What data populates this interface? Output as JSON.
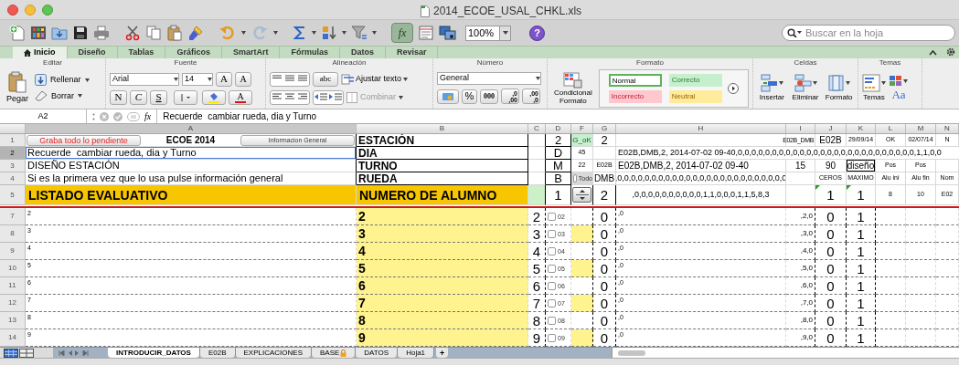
{
  "window": {
    "title": "2014_ECOE_USAL_CHKL.xls"
  },
  "toolbar": {
    "formula_button": "fx",
    "zoom": "100%",
    "help": "?",
    "search": {
      "placeholder": "Buscar en la hoja"
    }
  },
  "ribbon_tabs": [
    {
      "label": "Inicio",
      "selected": true
    },
    {
      "label": "Diseño",
      "selected": false
    },
    {
      "label": "Tablas",
      "selected": false
    },
    {
      "label": "Gráficos",
      "selected": false
    },
    {
      "label": "SmartArt",
      "selected": false
    },
    {
      "label": "Fórmulas",
      "selected": false
    },
    {
      "label": "Datos",
      "selected": false
    },
    {
      "label": "Revisar",
      "selected": false
    }
  ],
  "ribbon_groups": [
    {
      "kind": "edit",
      "label": "Editar",
      "paste": "Pegar",
      "fill": "Rellenar",
      "clear": "Borrar"
    },
    {
      "kind": "font",
      "label": "Fuente",
      "font": "Arial",
      "size": "14",
      "grow": "A",
      "shrink": "A",
      "bold": "N",
      "italic": "C",
      "underline": "S",
      "font_color": "A"
    },
    {
      "kind": "align",
      "label": "Alineación",
      "orientation": "abc",
      "wrap": "Ajustar texto",
      "merge": "Combinar",
      "merge_disabled": true
    },
    {
      "kind": "number",
      "label": "Número",
      "format": "General",
      "percent": "%",
      "thousands": "000",
      "decimals": [
        {
          "top": ",0",
          "bottom": ",00"
        },
        {
          "top": ",00",
          "bottom": ",0"
        }
      ]
    },
    {
      "kind": "styles",
      "label": "Formato",
      "conditional": "Condicional Formato",
      "styles": [
        {
          "label": "Normal",
          "selected": true,
          "color": "#ffffff"
        },
        {
          "label": "Correcto",
          "selected": false,
          "color": "#c6efce"
        },
        {
          "label": "Incorrecto",
          "selected": false,
          "color": "#ffc7ce"
        },
        {
          "label": "Neutral",
          "selected": false,
          "color": "#ffeb9c"
        }
      ]
    },
    {
      "kind": "cells",
      "label": "Celdas",
      "buttons": [
        "Insertar",
        "Eliminar",
        "Formato"
      ]
    },
    {
      "kind": "themes",
      "label": "Temas",
      "themes": "Temas",
      "fonts": "Aa"
    }
  ],
  "formula_bar": {
    "cell": "A2",
    "fx": "fx",
    "content": "Recuerde  cambiar rueda, dia y Turno"
  },
  "columns": [
    {
      "label": "A",
      "selected": true
    },
    {
      "label": "B",
      "selected": false
    },
    {
      "label": "C",
      "selected": false
    },
    {
      "label": "D",
      "selected": false
    },
    {
      "label": "F",
      "selected": false
    },
    {
      "label": "G",
      "selected": false
    },
    {
      "label": "H",
      "selected": false
    },
    {
      "label": "I",
      "selected": false
    },
    {
      "label": "J",
      "selected": false
    },
    {
      "label": "K",
      "selected": false
    },
    {
      "label": "L",
      "selected": false
    },
    {
      "label": "M",
      "selected": false
    },
    {
      "label": "N",
      "selected": false
    }
  ],
  "rows": [
    {
      "number": "1",
      "kind": "info",
      "selected": false,
      "cells": {
        "a": {
          "kind": "buttons",
          "items": [
            {
              "kind": "button",
              "text": "Graba todo lo pendiente",
              "alert": true
            },
            {
              "kind": "title",
              "text": "ECOE 2014"
            },
            {
              "kind": "button",
              "text": "Informacion General",
              "alert": false
            }
          ]
        },
        "b": {
          "kind": "label",
          "text": "ESTACIÓN"
        },
        "d": {
          "kind": "big",
          "text": "2"
        },
        "f": {
          "kind": "ok",
          "text": "G_oK"
        },
        "g": {
          "kind": "big",
          "text": "2"
        },
        "i": {
          "kind": "tiny",
          "text": "E02B_DMB"
        },
        "j": {
          "kind": "value",
          "text": "E02B"
        },
        "k": {
          "kind": "small",
          "text": "29/09/14"
        },
        "l": {
          "kind": "small",
          "text": "OK"
        },
        "m": {
          "kind": "small",
          "text": "02/07/14"
        },
        "n": {
          "kind": "small",
          "text": "N"
        }
      }
    },
    {
      "number": "2",
      "kind": "info",
      "selected": true,
      "cells": {
        "a": {
          "kind": "text",
          "text": "Recuerde  cambiar rueda, dia y Turno",
          "selected": true
        },
        "b": {
          "kind": "label",
          "text": "DIA"
        },
        "d": {
          "kind": "big",
          "text": "D"
        },
        "f": {
          "kind": "small",
          "text": "45"
        },
        "h": {
          "kind": "wide",
          "text": "E02B,DMB,2, 2014-07-02 09-40,0,0,0,0,0,0,0,0,0,0,0,0,0,0,0,0,0,0,0,0,0,0,0,0,0,0,1,1,0,0"
        }
      }
    },
    {
      "number": "3",
      "kind": "info",
      "selected": false,
      "cells": {
        "a": {
          "kind": "text",
          "text": "DISEÑO ESTACIÓN",
          "selected": false
        },
        "b": {
          "kind": "label",
          "text": "TURNO"
        },
        "d": {
          "kind": "big",
          "text": "M"
        },
        "f": {
          "kind": "small",
          "text": "22"
        },
        "g": {
          "kind": "small",
          "text": "E02B"
        },
        "h": {
          "kind": "data",
          "text": "E02B,DMB,2, 2014-07-02 09-40"
        },
        "i": {
          "kind": "value",
          "text": "15"
        },
        "j": {
          "kind": "value",
          "text": "90"
        },
        "k": {
          "kind": "boxed",
          "text": "diseño"
        },
        "l": {
          "kind": "small",
          "text": "Pos"
        },
        "m": {
          "kind": "small",
          "text": "Pos"
        }
      }
    },
    {
      "number": "4",
      "kind": "info",
      "selected": false,
      "cells": {
        "a": {
          "kind": "text",
          "text": "Si es la primera vez que lo usa pulse información general",
          "selected": false
        },
        "b": {
          "kind": "label",
          "text": "RUEDA"
        },
        "d": {
          "kind": "big",
          "text": "B"
        },
        "f": {
          "kind": "checkbox",
          "text": "Todo",
          "checked": false
        },
        "g": {
          "kind": "value",
          "text": "DMB"
        },
        "h": {
          "kind": "data_center",
          "text": ",0,0,0,0,0,0,0,0,0,0,0,0,0,0,0,0,0,0,0,0,0,0,0,0,0"
        },
        "j": {
          "kind": "small",
          "text": "CEROS"
        },
        "k": {
          "kind": "small",
          "text": "MAXIMO"
        },
        "l": {
          "kind": "small",
          "text": "Alu ini"
        },
        "m": {
          "kind": "small",
          "text": "Alu fin"
        },
        "n": {
          "kind": "small",
          "text": "Nom"
        }
      }
    },
    {
      "number": "5",
      "kind": "title",
      "selected": false,
      "cells": {
        "a": {
          "kind": "heading",
          "text": "LISTADO EVALUATIVO"
        },
        "b": {
          "kind": "heading",
          "text": "NUMERO DE ALUMNO"
        },
        "d": {
          "kind": "big",
          "text": "1"
        },
        "f": {
          "kind": "spinner"
        },
        "g": {
          "kind": "big",
          "text": "2"
        },
        "h": {
          "kind": "data_center",
          "text": ",0,0,0,0,0,0,0,0,0,0,1,1,0,0,0,1,1,5,8,3"
        },
        "j": {
          "kind": "big",
          "text": "1",
          "flag": true
        },
        "k": {
          "kind": "big",
          "text": "1",
          "flag": true
        },
        "l": {
          "kind": "small",
          "text": "8"
        },
        "m": {
          "kind": "small",
          "text": "10"
        },
        "n": {
          "kind": "small",
          "text": "E02"
        }
      }
    },
    {
      "number": "7",
      "kind": "item",
      "selected": false,
      "highlight": false,
      "cells": {
        "a": {
          "kind": "note",
          "text": "2"
        },
        "b": {
          "kind": "label",
          "text": "2"
        },
        "c": {
          "kind": "big",
          "text": "2"
        },
        "d": {
          "kind": "checkbox",
          "text": "02",
          "checked": false
        },
        "g": {
          "kind": "big",
          "text": "0"
        },
        "h": {
          "kind": "note",
          "text": ",0"
        },
        "i": {
          "kind": "note_right",
          "text": ",2,0"
        },
        "j": {
          "kind": "big",
          "text": "0"
        },
        "k": {
          "kind": "big",
          "text": "1"
        }
      }
    },
    {
      "number": "8",
      "kind": "item",
      "selected": false,
      "highlight": true,
      "cells": {
        "a": {
          "kind": "note",
          "text": "3"
        },
        "b": {
          "kind": "label",
          "text": "3"
        },
        "c": {
          "kind": "big",
          "text": "3"
        },
        "d": {
          "kind": "checkbox",
          "text": "03",
          "checked": false
        },
        "g": {
          "kind": "big",
          "text": "0"
        },
        "h": {
          "kind": "note",
          "text": ",0"
        },
        "i": {
          "kind": "note_right",
          "text": ",3,0"
        },
        "j": {
          "kind": "big",
          "text": "0"
        },
        "k": {
          "kind": "big",
          "text": "1"
        }
      }
    },
    {
      "number": "9",
      "kind": "item",
      "selected": false,
      "highlight": false,
      "cells": {
        "a": {
          "kind": "note",
          "text": "4"
        },
        "b": {
          "kind": "label",
          "text": "4"
        },
        "c": {
          "kind": "big",
          "text": "4"
        },
        "d": {
          "kind": "checkbox",
          "text": "04",
          "checked": false
        },
        "g": {
          "kind": "big",
          "text": "0"
        },
        "h": {
          "kind": "note",
          "text": ",0"
        },
        "i": {
          "kind": "note_right",
          "text": ",4,0"
        },
        "j": {
          "kind": "big",
          "text": "0"
        },
        "k": {
          "kind": "big",
          "text": "1"
        }
      }
    },
    {
      "number": "10",
      "kind": "item",
      "selected": false,
      "highlight": true,
      "cells": {
        "a": {
          "kind": "note",
          "text": "5"
        },
        "b": {
          "kind": "label",
          "text": "5"
        },
        "c": {
          "kind": "big",
          "text": "5"
        },
        "d": {
          "kind": "checkbox",
          "text": "05",
          "checked": false
        },
        "g": {
          "kind": "big",
          "text": "0"
        },
        "h": {
          "kind": "note",
          "text": ",0"
        },
        "i": {
          "kind": "note_right",
          "text": ",5,0"
        },
        "j": {
          "kind": "big",
          "text": "0"
        },
        "k": {
          "kind": "big",
          "text": "1"
        }
      }
    },
    {
      "number": "11",
      "kind": "item",
      "selected": false,
      "highlight": false,
      "cells": {
        "a": {
          "kind": "note",
          "text": "6"
        },
        "b": {
          "kind": "label",
          "text": "6"
        },
        "c": {
          "kind": "big",
          "text": "6"
        },
        "d": {
          "kind": "checkbox",
          "text": "06",
          "checked": false
        },
        "g": {
          "kind": "big",
          "text": "0"
        },
        "h": {
          "kind": "note",
          "text": ",0"
        },
        "i": {
          "kind": "note_right",
          "text": ",6,0"
        },
        "j": {
          "kind": "big",
          "text": "0"
        },
        "k": {
          "kind": "big",
          "text": "1"
        }
      }
    },
    {
      "number": "12",
      "kind": "item",
      "selected": false,
      "highlight": true,
      "cells": {
        "a": {
          "kind": "note",
          "text": "7"
        },
        "b": {
          "kind": "label",
          "text": "7"
        },
        "c": {
          "kind": "big",
          "text": "7"
        },
        "d": {
          "kind": "checkbox",
          "text": "07",
          "checked": false
        },
        "g": {
          "kind": "big",
          "text": "0"
        },
        "h": {
          "kind": "note",
          "text": ",0"
        },
        "i": {
          "kind": "note_right",
          "text": ",7,0"
        },
        "j": {
          "kind": "big",
          "text": "0"
        },
        "k": {
          "kind": "big",
          "text": "1"
        }
      }
    },
    {
      "number": "13",
      "kind": "item",
      "selected": false,
      "highlight": false,
      "cells": {
        "a": {
          "kind": "note",
          "text": "8"
        },
        "b": {
          "kind": "label",
          "text": "8"
        },
        "c": {
          "kind": "big",
          "text": "8"
        },
        "d": {
          "kind": "checkbox",
          "text": "08",
          "checked": false
        },
        "g": {
          "kind": "big",
          "text": "0"
        },
        "h": {
          "kind": "note",
          "text": ",0"
        },
        "i": {
          "kind": "note_right",
          "text": ",8,0"
        },
        "j": {
          "kind": "big",
          "text": "0"
        },
        "k": {
          "kind": "big",
          "text": "1"
        }
      }
    },
    {
      "number": "14",
      "kind": "item",
      "selected": false,
      "highlight": true,
      "cells": {
        "a": {
          "kind": "note",
          "text": "9"
        },
        "b": {
          "kind": "label",
          "text": "9"
        },
        "c": {
          "kind": "big",
          "text": "9"
        },
        "d": {
          "kind": "checkbox",
          "text": "09",
          "checked": false
        },
        "g": {
          "kind": "big",
          "text": "0"
        },
        "h": {
          "kind": "note",
          "text": ",0"
        },
        "i": {
          "kind": "note_right",
          "text": ",9,0"
        },
        "j": {
          "kind": "big",
          "text": "0"
        },
        "k": {
          "kind": "big",
          "text": "1"
        }
      }
    }
  ],
  "sheet_tabs": [
    {
      "label": "INTRODUCIR_DATOS",
      "selected": true,
      "locked": false
    },
    {
      "label": "E02B",
      "selected": false,
      "locked": false
    },
    {
      "label": "EXPLICACIONES",
      "selected": false,
      "locked": false
    },
    {
      "label": "BASE",
      "selected": false,
      "locked": true
    },
    {
      "label": "DATOS",
      "selected": false,
      "locked": false
    },
    {
      "label": "Hoja1",
      "selected": false,
      "locked": false
    }
  ],
  "add_sheet": "+"
}
